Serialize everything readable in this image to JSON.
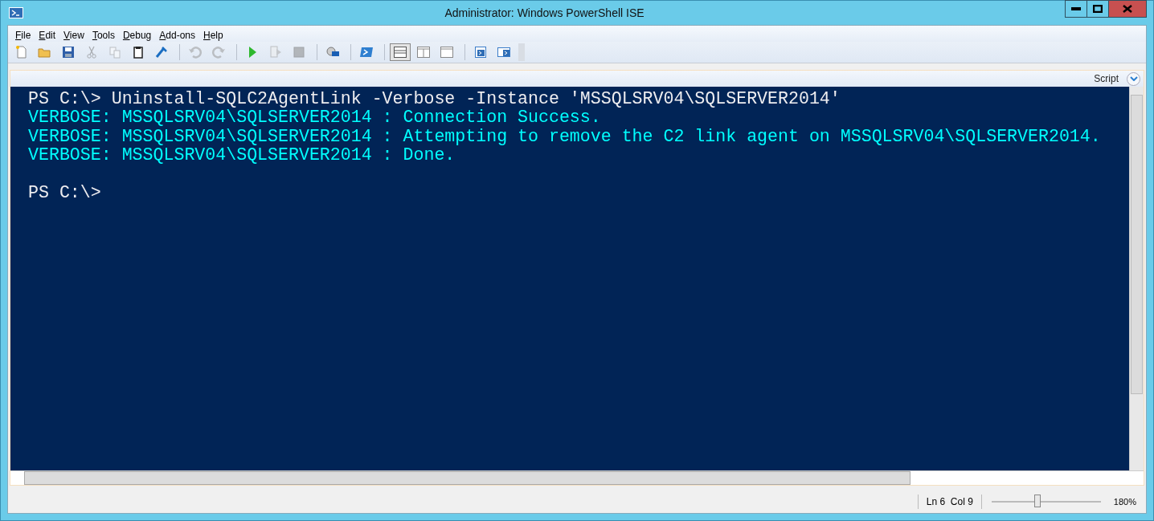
{
  "window": {
    "title": "Administrator: Windows PowerShell ISE"
  },
  "menu": [
    {
      "label": "File"
    },
    {
      "label": "Edit"
    },
    {
      "label": "View"
    },
    {
      "label": "Tools"
    },
    {
      "label": "Debug"
    },
    {
      "label": "Add-ons"
    },
    {
      "label": "Help"
    }
  ],
  "toolbar": [
    [
      {
        "kind": "new",
        "disabled": false
      },
      {
        "kind": "open",
        "disabled": false
      },
      {
        "kind": "save",
        "disabled": false
      },
      {
        "kind": "cut",
        "disabled": true
      },
      {
        "kind": "copy",
        "disabled": true
      },
      {
        "kind": "paste",
        "disabled": false
      },
      {
        "kind": "clear",
        "disabled": false
      }
    ],
    [
      {
        "kind": "undo",
        "disabled": true
      },
      {
        "kind": "redo",
        "disabled": true
      }
    ],
    [
      {
        "kind": "run",
        "disabled": false
      },
      {
        "kind": "run-selection",
        "disabled": true
      },
      {
        "kind": "stop",
        "disabled": true
      }
    ],
    [
      {
        "kind": "remote",
        "disabled": false
      }
    ],
    [
      {
        "kind": "powershell",
        "disabled": false
      }
    ],
    [
      {
        "kind": "layout-top",
        "disabled": false,
        "selected": true
      },
      {
        "kind": "layout-right",
        "disabled": false,
        "selected": false
      },
      {
        "kind": "layout-max",
        "disabled": false,
        "selected": false
      }
    ],
    [
      {
        "kind": "show-script",
        "disabled": false
      },
      {
        "kind": "show-console",
        "disabled": false
      }
    ]
  ],
  "script_bar": {
    "label": "Script"
  },
  "console": {
    "lines": [
      {
        "kind": "prompt",
        "text": "PS C:\\> Uninstall-SQLC2AgentLink -Verbose -Instance 'MSSQLSRV04\\SQLSERVER2014'"
      },
      {
        "kind": "verbose",
        "text": "VERBOSE: MSSQLSRV04\\SQLSERVER2014 : Connection Success."
      },
      {
        "kind": "verbose",
        "text": "VERBOSE: MSSQLSRV04\\SQLSERVER2014 : Attempting to remove the C2 link agent on MSSQLSRV04\\SQLSERVER2014."
      },
      {
        "kind": "verbose",
        "text": "VERBOSE: MSSQLSRV04\\SQLSERVER2014 : Done."
      },
      {
        "kind": "blank"
      },
      {
        "kind": "prompt",
        "text": "PS C:\\>"
      }
    ]
  },
  "status_bar": {
    "position": "Ln 6  Col 9",
    "zoom": {
      "level": 0.42,
      "reading": "180%"
    }
  }
}
